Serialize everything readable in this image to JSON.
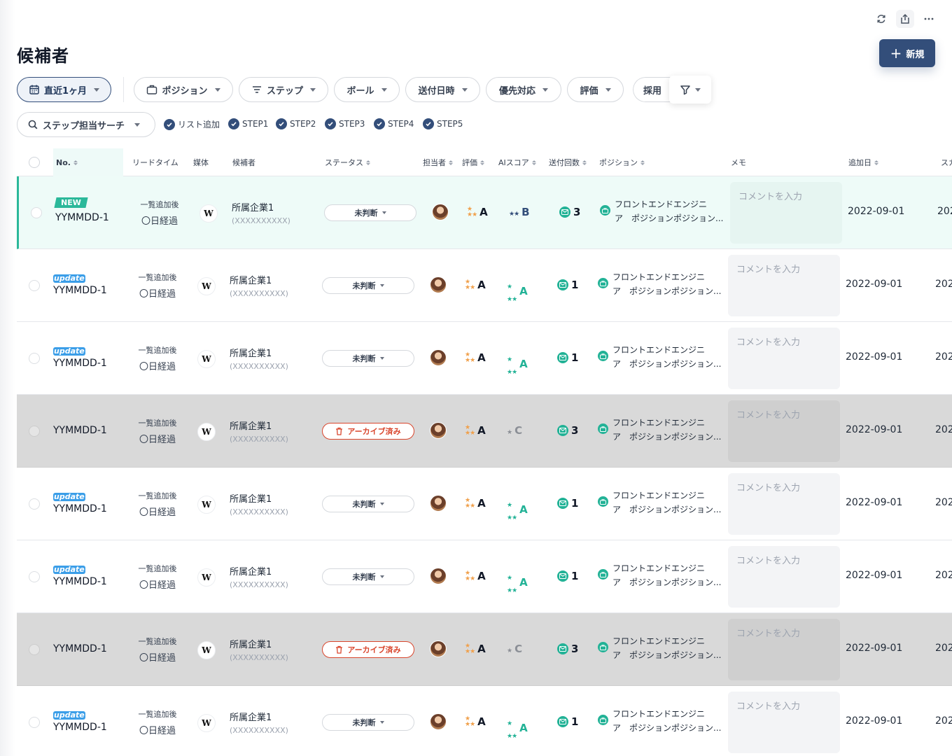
{
  "header": {
    "title": "候補者",
    "new_button_label": "新規"
  },
  "filters": {
    "chips": [
      "直近1ヶ月",
      "ポジション",
      "ステップ",
      "ボール",
      "送付日時",
      "優先対応",
      "評価",
      "採用"
    ],
    "search_label": "ステップ担当サーチ",
    "checks": [
      "リスト追加",
      "STEP1",
      "STEP2",
      "STEP3",
      "STEP4",
      "STEP5"
    ]
  },
  "table": {
    "columns": {
      "no": "No.",
      "lead": "リードタイム",
      "media": "媒体",
      "candidate": "候補者",
      "status": "ステータス",
      "owner": "担当者",
      "rating": "評価",
      "ai": "AIスコア",
      "send": "送付回数",
      "position": "ポジション",
      "memo": "メモ",
      "added": "追加日",
      "sc": "スカ"
    },
    "rows": [
      {
        "badge": "NEW",
        "no": "YYMMDD-1",
        "lead1": "一覧追加後",
        "lead2": "〇日経過",
        "media": "W",
        "company": "所属企業1",
        "sub": "(XXXXXXXXXX)",
        "status": "未判断",
        "rating": "A",
        "ai": "B",
        "send": "3",
        "pos1": "フロントエンドエンジニ",
        "pos2": "ア　ポジションポジション...",
        "memo": "コメントを入力",
        "added": "2022-09-01",
        "sc": "202"
      },
      {
        "badge": "update",
        "no": "YYMMDD-1",
        "lead1": "一覧追加後",
        "lead2": "〇日経過",
        "media": "W",
        "company": "所属企業1",
        "sub": "(XXXXXXXXXX)",
        "status": "未判断",
        "rating": "A",
        "ai": "A",
        "send": "1",
        "pos1": "フロントエンドエンジニ",
        "pos2": "ア　ポジションポジション...",
        "memo": "コメントを入力",
        "added": "2022-09-01",
        "sc": "202"
      },
      {
        "badge": "update",
        "no": "YYMMDD-1",
        "lead1": "一覧追加後",
        "lead2": "〇日経過",
        "media": "W",
        "company": "所属企業1",
        "sub": "(XXXXXXXXXX)",
        "status": "未判断",
        "rating": "A",
        "ai": "A",
        "send": "1",
        "pos1": "フロントエンドエンジニ",
        "pos2": "ア　ポジションポジション...",
        "memo": "コメントを入力",
        "added": "2022-09-01",
        "sc": "202"
      },
      {
        "badge": "",
        "no": "YYMMDD-1",
        "lead1": "一覧追加後",
        "lead2": "〇日経過",
        "media": "W",
        "company": "所属企業1",
        "sub": "(XXXXXXXXXX)",
        "status": "アーカイブ済み",
        "rating": "A",
        "ai": "C",
        "send": "3",
        "pos1": "フロントエンドエンジニ",
        "pos2": "ア　ポジションポジション...",
        "memo": "コメントを入力",
        "added": "2022-09-01",
        "sc": "202"
      },
      {
        "badge": "update",
        "no": "YYMMDD-1",
        "lead1": "一覧追加後",
        "lead2": "〇日経過",
        "media": "W",
        "company": "所属企業1",
        "sub": "(XXXXXXXXXX)",
        "status": "未判断",
        "rating": "A",
        "ai": "A",
        "send": "1",
        "pos1": "フロントエンドエンジニ",
        "pos2": "ア　ポジションポジション...",
        "memo": "コメントを入力",
        "added": "2022-09-01",
        "sc": "202"
      },
      {
        "badge": "update",
        "no": "YYMMDD-1",
        "lead1": "一覧追加後",
        "lead2": "〇日経過",
        "media": "W",
        "company": "所属企業1",
        "sub": "(XXXXXXXXXX)",
        "status": "未判断",
        "rating": "A",
        "ai": "A",
        "send": "1",
        "pos1": "フロントエンドエンジニ",
        "pos2": "ア　ポジションポジション...",
        "memo": "コメントを入力",
        "added": "2022-09-01",
        "sc": "202"
      },
      {
        "badge": "",
        "no": "YYMMDD-1",
        "lead1": "一覧追加後",
        "lead2": "〇日経過",
        "media": "W",
        "company": "所属企業1",
        "sub": "(XXXXXXXXXX)",
        "status": "アーカイブ済み",
        "rating": "A",
        "ai": "C",
        "send": "3",
        "pos1": "フロントエンドエンジニ",
        "pos2": "ア　ポジションポジション...",
        "memo": "コメントを入力",
        "added": "2022-09-01",
        "sc": "202"
      },
      {
        "badge": "update",
        "no": "YYMMDD-1",
        "lead1": "一覧追加後",
        "lead2": "〇日経過",
        "media": "W",
        "company": "所属企業1",
        "sub": "(XXXXXXXXXX)",
        "status": "未判断",
        "rating": "A",
        "ai": "A",
        "send": "1",
        "pos1": "フロントエンドエンジニ",
        "pos2": "ア　ポジションポジション...",
        "memo": "コメントを入力",
        "added": "2022-09-01",
        "sc": "202"
      }
    ]
  },
  "colors": {
    "brand": "#334e7a",
    "accent_green": "#22b296",
    "archive_red": "#d9452c",
    "star_orange": "#f0a04b"
  }
}
